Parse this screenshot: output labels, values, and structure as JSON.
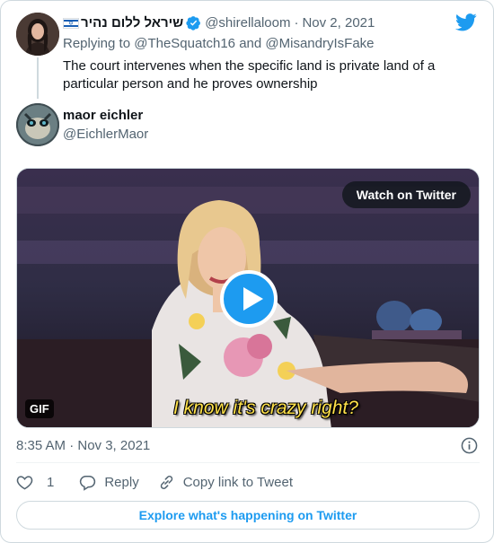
{
  "parent_tweet": {
    "display_name": "שיראל ללום נהיר",
    "flag_icon": "israel-flag-icon",
    "verified_icon": "verified-badge-icon",
    "handle": "@shirellaloom",
    "separator": "·",
    "date": "Nov 2, 2021",
    "replying_prefix": "Replying to",
    "replying_user_1": "@TheSquatch16",
    "replying_and": "and",
    "replying_user_2": "@MisandryIsFake",
    "text": "The court intervenes when the specific land is private land of a particular person and he proves ownership"
  },
  "main_tweet": {
    "display_name": "maor eichler",
    "handle": "@EichlerMaor",
    "media": {
      "watch_label": "Watch on Twitter",
      "gif_label": "GIF",
      "caption": "I know it's crazy right?"
    },
    "timestamp": "8:35 AM · Nov 3, 2021"
  },
  "actions": {
    "like_count": "1",
    "reply_label": "Reply",
    "copy_label": "Copy link to Tweet"
  },
  "explore_label": "Explore what's happening on Twitter",
  "colors": {
    "accent": "#1d9bf0",
    "muted_text": "#536471",
    "border": "#cfd9de",
    "caption": "#ffe14a"
  }
}
